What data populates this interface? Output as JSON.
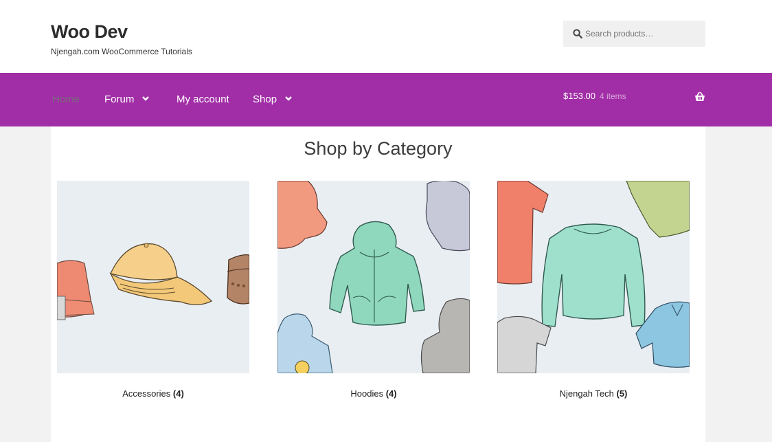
{
  "site": {
    "title": "Woo Dev",
    "description": "Njengah.com WooCommerce Tutorials"
  },
  "search": {
    "placeholder": "Search products…",
    "icon": "search-icon"
  },
  "nav": {
    "items": [
      {
        "label": "Home",
        "active": true
      },
      {
        "label": "Forum",
        "has_dropdown": true
      },
      {
        "label": "My account"
      },
      {
        "label": "Shop",
        "has_dropdown": true
      }
    ]
  },
  "cart": {
    "total": "$153.00",
    "count": "4 items",
    "icon": "basket-icon"
  },
  "main": {
    "section_title": "Shop by Category",
    "categories": [
      {
        "name": "Accessories",
        "count": "(4)"
      },
      {
        "name": "Hoodies",
        "count": "(4)"
      },
      {
        "name": "Njengah Tech",
        "count": "(5)"
      }
    ]
  },
  "colors": {
    "nav_bg": "#a12ea6",
    "page_bg": "#f2f2f2",
    "image_bg": "#e9eef3"
  }
}
